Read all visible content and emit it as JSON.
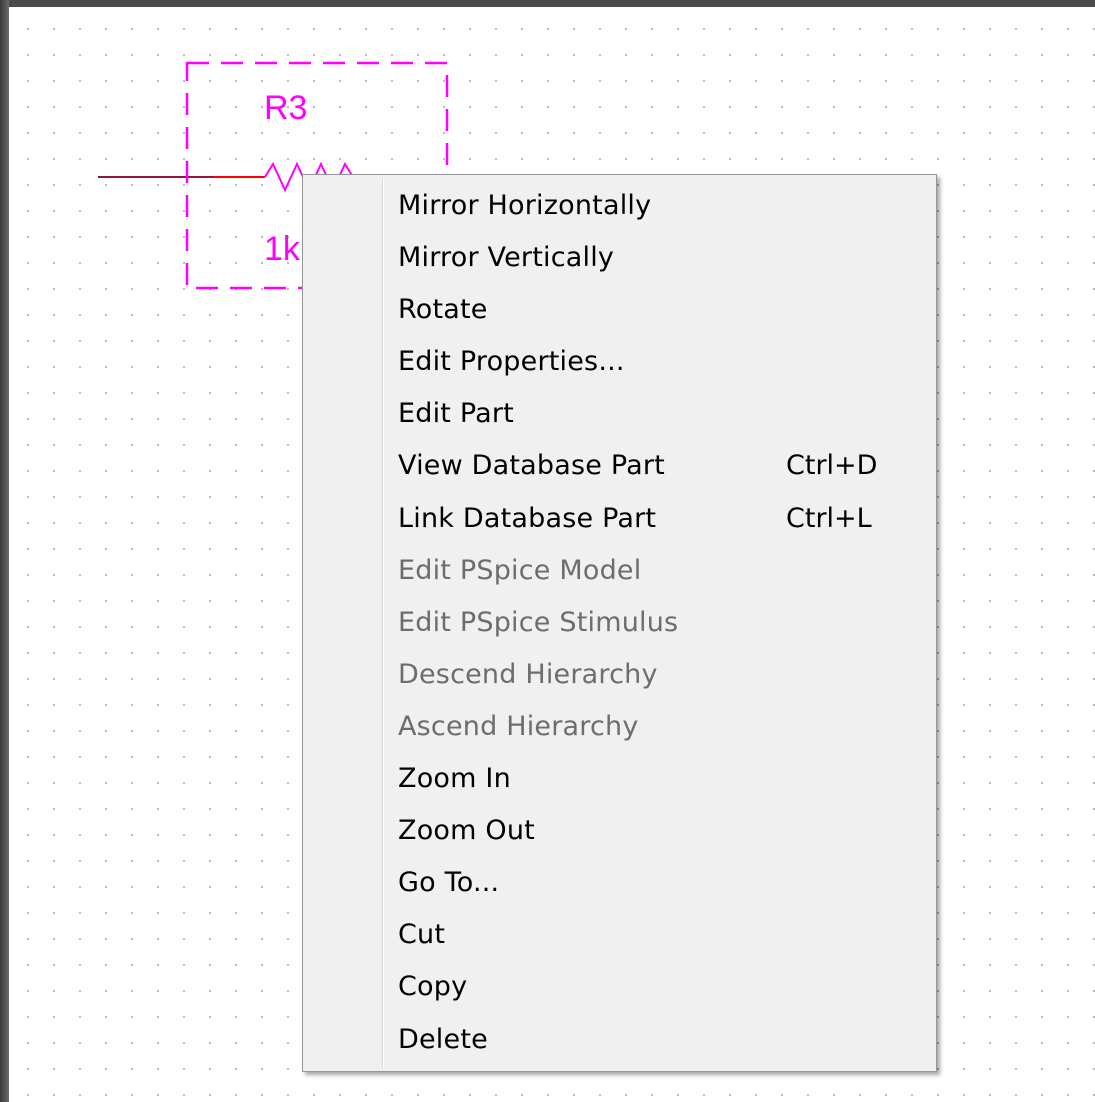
{
  "schematic": {
    "part_reference": "R3",
    "part_value": "1k",
    "part_value_visible": "10",
    "colors": {
      "part": "#ff00ff",
      "wire": "#8b1a3a",
      "selected_pin": "#ff0000",
      "grid_dot": "#b8b8b8"
    }
  },
  "context_menu": {
    "items": [
      {
        "label": "Mirror Horizontally",
        "shortcut": "",
        "enabled": true
      },
      {
        "label": "Mirror Vertically",
        "shortcut": "",
        "enabled": true
      },
      {
        "label": "Rotate",
        "shortcut": "",
        "enabled": true
      },
      {
        "label": "Edit Properties...",
        "shortcut": "",
        "enabled": true
      },
      {
        "label": "Edit Part",
        "shortcut": "",
        "enabled": true
      },
      {
        "label": "View Database Part",
        "shortcut": "Ctrl+D",
        "enabled": true
      },
      {
        "label": "Link Database Part",
        "shortcut": "Ctrl+L",
        "enabled": true
      },
      {
        "label": "Edit PSpice Model",
        "shortcut": "",
        "enabled": false
      },
      {
        "label": "Edit PSpice Stimulus",
        "shortcut": "",
        "enabled": false
      },
      {
        "label": "Descend Hierarchy",
        "shortcut": "",
        "enabled": false
      },
      {
        "label": "Ascend Hierarchy",
        "shortcut": "",
        "enabled": false
      },
      {
        "label": "Zoom In",
        "shortcut": "",
        "enabled": true
      },
      {
        "label": "Zoom Out",
        "shortcut": "",
        "enabled": true
      },
      {
        "label": "Go To...",
        "shortcut": "",
        "enabled": true
      },
      {
        "label": "Cut",
        "shortcut": "",
        "enabled": true
      },
      {
        "label": "Copy",
        "shortcut": "",
        "enabled": true
      },
      {
        "label": "Delete",
        "shortcut": "",
        "enabled": true
      }
    ]
  }
}
